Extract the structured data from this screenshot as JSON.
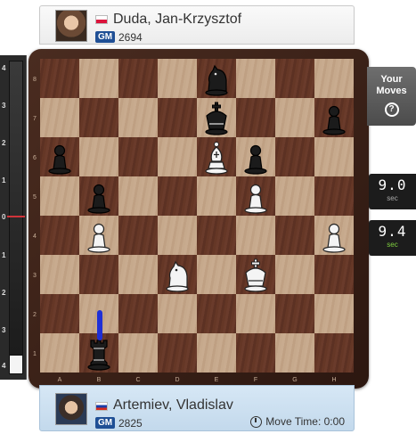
{
  "players": {
    "top": {
      "name": "Duda, Jan-Krzysztof",
      "title": "GM",
      "rating": "2694",
      "flag": "pl"
    },
    "bottom": {
      "name": "Artemiev, Vladislav",
      "title": "GM",
      "rating": "2825",
      "flag": "ru",
      "move_time_label": "Move Time: 0:00"
    }
  },
  "eval_bar": {
    "ticks": [
      "4",
      "3",
      "2",
      "1",
      "0",
      "1",
      "2",
      "3",
      "4"
    ]
  },
  "side_panel": {
    "your_moves_label": "Your Moves",
    "help_icon_glyph": "?",
    "opponent_clock": "9.0",
    "opponent_clock_unit": "sec",
    "player_clock": "9.4",
    "player_clock_unit": "sec"
  },
  "board": {
    "ranks": [
      "8",
      "7",
      "6",
      "5",
      "4",
      "3",
      "2",
      "1"
    ],
    "files": [
      "A",
      "B",
      "C",
      "D",
      "E",
      "F",
      "G",
      "H"
    ],
    "pieces": [
      {
        "square": "e8",
        "piece": "knight",
        "color": "black"
      },
      {
        "square": "e7",
        "piece": "king",
        "color": "black"
      },
      {
        "square": "h7",
        "piece": "pawn",
        "color": "black"
      },
      {
        "square": "a6",
        "piece": "pawn",
        "color": "black"
      },
      {
        "square": "e6",
        "piece": "bishop",
        "color": "white"
      },
      {
        "square": "f6",
        "piece": "pawn",
        "color": "black"
      },
      {
        "square": "b5",
        "piece": "pawn",
        "color": "black"
      },
      {
        "square": "f5",
        "piece": "pawn",
        "color": "white"
      },
      {
        "square": "b4",
        "piece": "pawn",
        "color": "white"
      },
      {
        "square": "h4",
        "piece": "pawn",
        "color": "white"
      },
      {
        "square": "d3",
        "piece": "knight",
        "color": "white"
      },
      {
        "square": "f3",
        "piece": "king",
        "color": "white"
      },
      {
        "square": "b1",
        "piece": "rook",
        "color": "black"
      }
    ],
    "highlight_color": "#1f2fd6"
  }
}
